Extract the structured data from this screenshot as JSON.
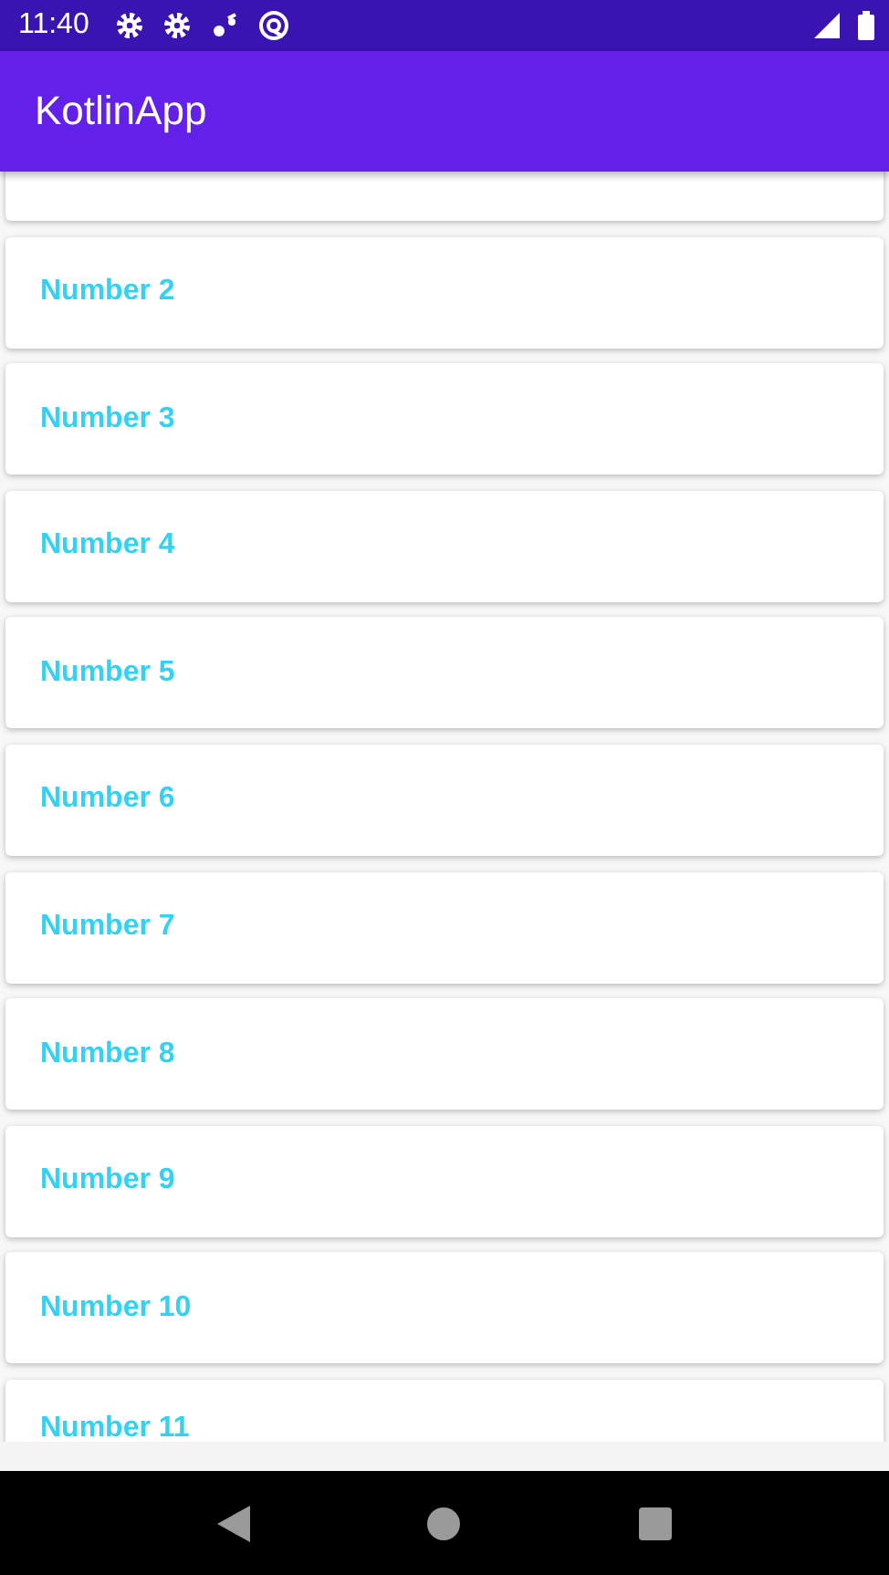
{
  "status_bar": {
    "time": "11:40"
  },
  "app_bar": {
    "title": "KotlinApp"
  },
  "list": {
    "items": [
      {
        "label": "Number 2"
      },
      {
        "label": "Number 3"
      },
      {
        "label": "Number 4"
      },
      {
        "label": "Number 5"
      },
      {
        "label": "Number 6"
      },
      {
        "label": "Number 7"
      },
      {
        "label": "Number 8"
      },
      {
        "label": "Number 9"
      },
      {
        "label": "Number 10"
      },
      {
        "label": "Number 11"
      }
    ]
  }
}
